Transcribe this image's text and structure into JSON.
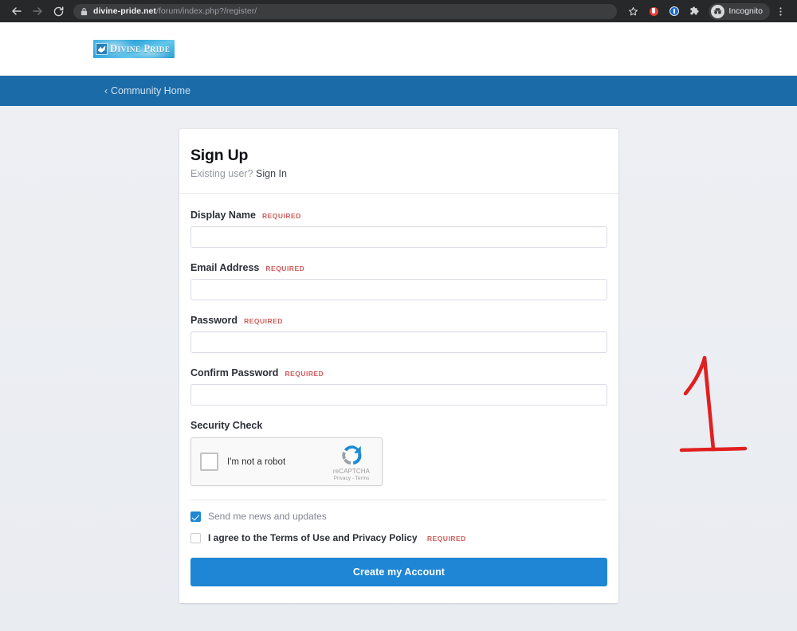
{
  "browser": {
    "back_icon": "back-arrow-icon",
    "forward_icon": "forward-arrow-icon",
    "reload_icon": "reload-icon",
    "lock_icon": "lock-icon",
    "url_host": "divine-pride.net",
    "url_path": "/forum/index.php?/register/",
    "bookmark_icon": "star-icon",
    "extension_icons": [
      "shield-extension-icon",
      "password-manager-icon",
      "puzzle-extensions-icon"
    ],
    "profile_label": "Incognito",
    "profile_icon": "incognito-avatar-icon",
    "menu_icon": "three-dot-menu-icon"
  },
  "site": {
    "logo_text": "Divine Pride",
    "logo_mark_icon": "wing-logo-icon",
    "nav": {
      "back_chevron": "‹",
      "community_home_label": "Community Home"
    }
  },
  "form": {
    "title": "Sign Up",
    "existing_user_text": "Existing user?",
    "sign_in_label": "Sign In",
    "required_badge": "REQUIRED",
    "fields": [
      {
        "label": "Display Name",
        "value": "",
        "placeholder": "",
        "required": true,
        "type": "text"
      },
      {
        "label": "Email Address",
        "value": "",
        "placeholder": "",
        "required": true,
        "type": "text"
      },
      {
        "label": "Password",
        "value": "",
        "placeholder": "",
        "required": true,
        "type": "password"
      },
      {
        "label": "Confirm Password",
        "value": "",
        "placeholder": "",
        "required": true,
        "type": "password"
      }
    ],
    "security_check": {
      "label": "Security Check",
      "checkbox_label": "I'm not a robot",
      "brand_name": "reCAPTCHA",
      "legal": "Privacy - Terms",
      "logo_icon": "recaptcha-logo-icon",
      "checked": false
    },
    "newsletter": {
      "label": "Send me news and updates",
      "checked": true
    },
    "terms": {
      "label": "I agree to the Terms of Use and Privacy Policy",
      "required_badge": "REQUIRED",
      "checked": false
    },
    "submit_label": "Create my Account"
  },
  "annotation": {
    "text": "1",
    "color": "#e02020"
  },
  "colors": {
    "nav_blue": "#1b6ba8",
    "button_blue": "#1e86d4",
    "required_red": "#d25b5b",
    "page_bg": "#edeff3",
    "annotation_red": "#e02020"
  }
}
